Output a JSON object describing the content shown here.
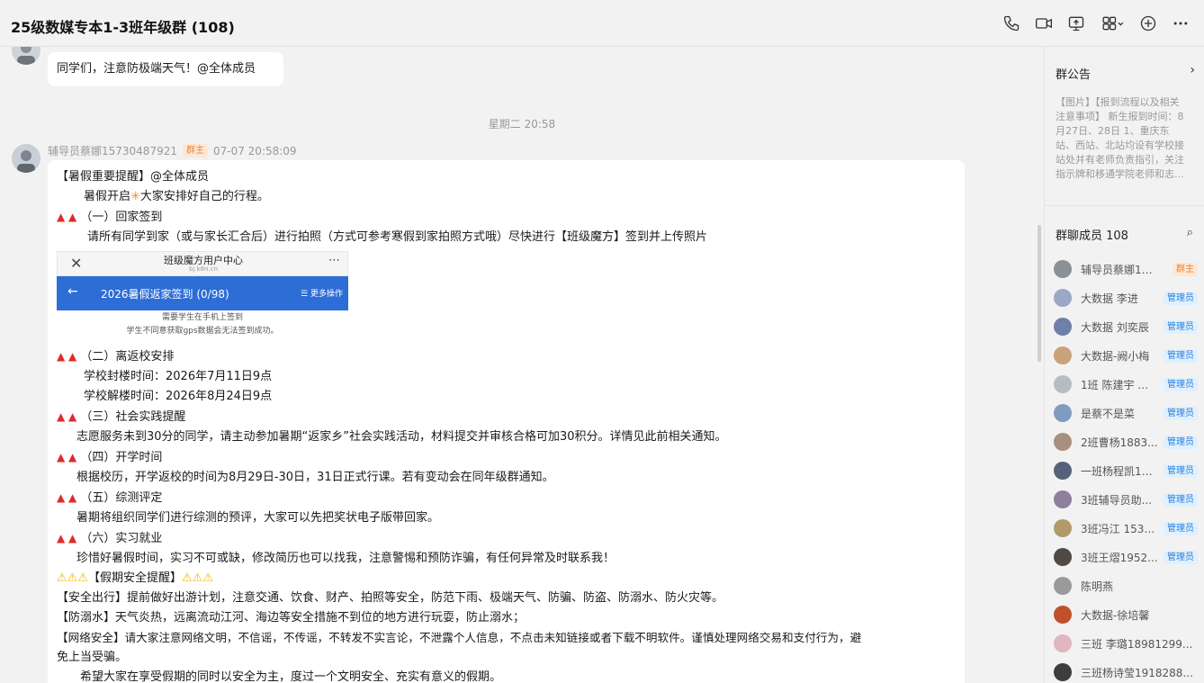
{
  "window": {
    "title": "25级数媒专本1-3班年级群 (108)"
  },
  "toolbar": {
    "icons": [
      "phone-icon",
      "video-icon",
      "screen-share-icon",
      "apps-icon",
      "add-icon",
      "more-icon"
    ]
  },
  "chat": {
    "prev_message": {
      "text": "同学们，注意防极端天气！@全体成员"
    },
    "time_separator": "星期二 20:58",
    "message": {
      "sender": "辅导员蔡娜15730487921",
      "role_badge": "群主",
      "timestamp": "07-07 20:58:09",
      "lines": {
        "l1": "【暑假重要提醒】@全体成员",
        "l2a": "暑假开启",
        "l2b": "大家安排好自己的行程。",
        "l3": "（一）回家签到",
        "l4": "请所有同学到家（或与家长汇合后）进行拍照（方式可参考寒假到家拍照方式哦）尽快进行【班级魔方】签到并上传照片",
        "l5": "（二）离返校安排",
        "l6": "学校封楼时间：2026年7月11日9点",
        "l7": "学校解楼时间：2026年8月24日9点",
        "l8": "（三）社会实践提醒",
        "l9": "志愿服务未到30分的同学，请主动参加暑期“返家乡”社会实践活动，材料提交并审核合格可加30积分。详情见此前相关通知。",
        "l10": "（四）开学时间",
        "l11": "根据校历，开学返校的时间为8月29日-30日，31日正式行课。若有变动会在同年级群通知。",
        "l12": "（五）综测评定",
        "l13": "暑期将组织同学们进行综测的预评，大家可以先把奖状电子版带回家。",
        "l14": "（六）实习就业",
        "l15": "珍惜好暑假时间，实习不可或缺，修改简历也可以找我，注意警惕和预防诈骗，有任何异常及时联系我！",
        "l16": "【假期安全提醒】",
        "l17": "【安全出行】提前做好出游计划，注意交通、饮食、财产、拍照等安全，防范下雨、极端天气、防骗、防盗、防溺水、防火灾等。",
        "l18": "【防溺水】天气炎热，远离流动江河、海边等安全措施不到位的地方进行玩耍，防止溺水；",
        "l19a": "【网络安全】请大家注意网络文明，不信谣，不传谣，不转发不实言论，不泄露个人信息，不点击未知链接或者下载不明软件。谨慎处理网络交易和支付行为，避",
        "l19b": "免上当受骗。",
        "l20": "希望大家在享受假期的同时以安全为主，度过一个文明安全、充实有意义的假期。"
      },
      "embed": {
        "app_title": "班级魔方用户中心",
        "app_url": "bj.k8n.cn",
        "checkin_title": "2026暑假返家签到 (0/98)",
        "more_ops": "更多操作",
        "note1": "需要学生在手机上签到",
        "note2": "学生不同意获取gps数据会无法签到成功。"
      }
    }
  },
  "sidebar": {
    "announcement": {
      "title": "群公告",
      "lines": [
        "【图片】【报到流程以及相关",
        "注意事项】 新生报到时间：8",
        "月27日、28日 1、重庆东",
        "站、西站、北站均设有学校接",
        "站处并有老师负责指引，关注",
        "指示牌和移通学院老师和志..."
      ]
    },
    "members": {
      "title": "群聊成员 108",
      "list": [
        {
          "name": "辅导员蔡娜157...",
          "badge": "群主"
        },
        {
          "name": "大数据 李进",
          "badge": "管理员"
        },
        {
          "name": "大数据 刘奕辰",
          "badge": "管理员"
        },
        {
          "name": "大数据-阙小梅",
          "badge": "管理员"
        },
        {
          "name": "1班 陈建宇 辅...",
          "badge": "管理员"
        },
        {
          "name": "是蔡不是菜",
          "badge": "管理员"
        },
        {
          "name": "2班曹杨1883...",
          "badge": "管理员"
        },
        {
          "name": "一班杨程凯18...",
          "badge": "管理员"
        },
        {
          "name": "3班辅导员助...",
          "badge": "管理员"
        },
        {
          "name": "3班冯江 1539...",
          "badge": "管理员"
        },
        {
          "name": "3班王熠1952...",
          "badge": "管理员"
        },
        {
          "name": "陈明燕",
          "badge": ""
        },
        {
          "name": "大数据-徐培馨",
          "badge": ""
        },
        {
          "name": "三班 李璐18981299...",
          "badge": ""
        },
        {
          "name": "三班杨诗莹1918288...",
          "badge": ""
        }
      ]
    }
  }
}
